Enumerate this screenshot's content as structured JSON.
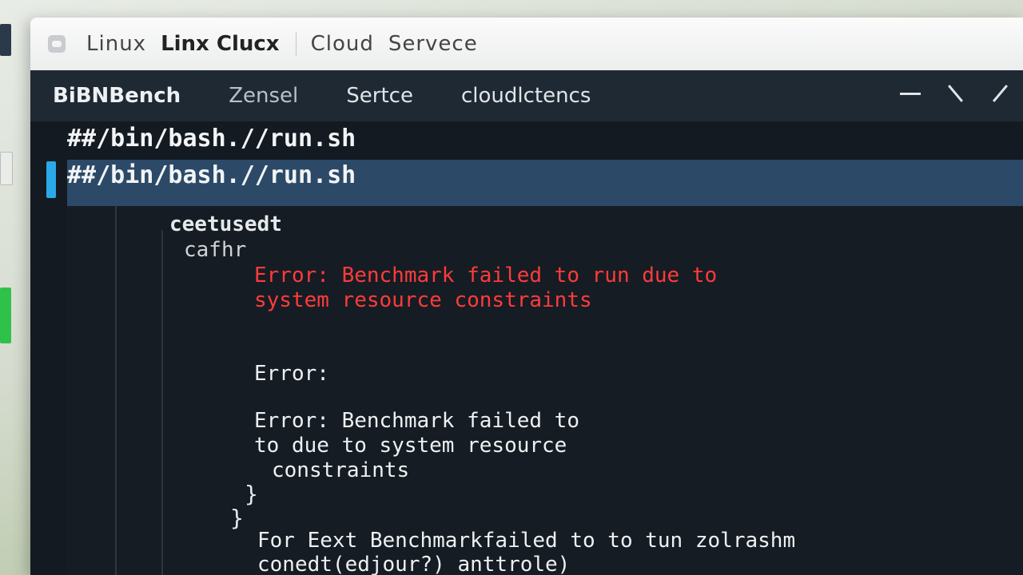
{
  "window": {
    "title_part1": "Linux",
    "title_part2": "Linx Clucx",
    "title_part3": "Cloud",
    "title_part4": "Servece"
  },
  "menu": {
    "items": [
      "BiBNBench",
      "Zensel",
      "Sertce",
      "cloudlctencs"
    ]
  },
  "terminal": {
    "shebang_lines": [
      "##/bin/bash.//run.sh",
      "##/bin/bash.//run.sh"
    ],
    "block_header": "ceetusedt",
    "block_sub": "cafhr",
    "error_red_line1": "Error: Benchmark failed to run due to",
    "error_red_line2": "system resource constraints",
    "error_empty": "Error:",
    "error_line1": "Error: Benchmark failed to",
    "error_line2": "to due to system resource",
    "error_line3": "constraints",
    "close_brace_inner": "}",
    "close_brace_outer": "}",
    "footer_line1": "For Eext Benchmarkfailed to to tun zolrashm",
    "footer_line2": "conedt(edjour?) anttrole)"
  },
  "colors": {
    "error_red": "#ff3b3b",
    "highlight": "#2c4a68",
    "cursor_marker": "#29a9e8",
    "terminal_bg": "#141a21"
  }
}
